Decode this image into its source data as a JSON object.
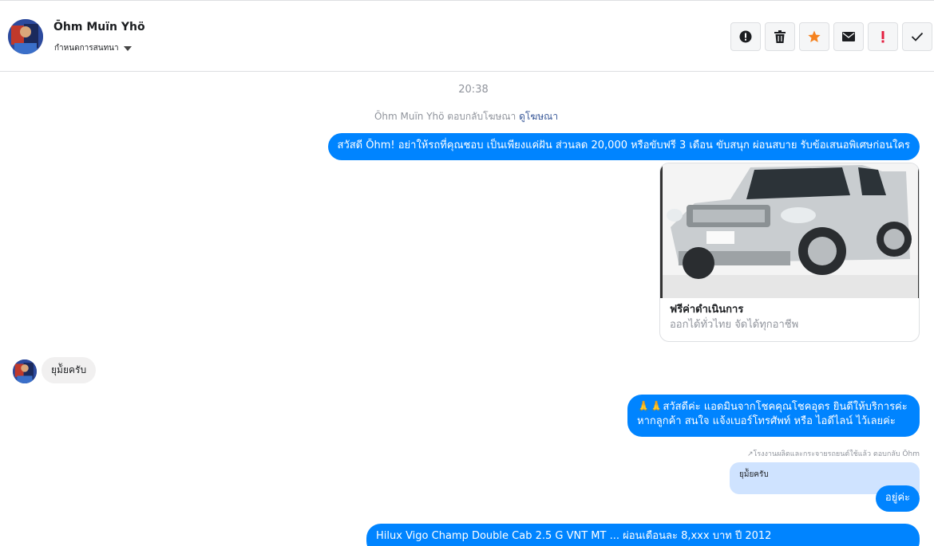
{
  "header": {
    "contact_name": "Ōhm Muïn Yhö",
    "assign_label": "กำหนดการสนทนา"
  },
  "toolbar": {
    "buttons": [
      {
        "name": "spam-button",
        "icon": "alert-circle-icon"
      },
      {
        "name": "delete-button",
        "icon": "trash-icon"
      },
      {
        "name": "star-button",
        "icon": "star-icon",
        "color": "#f5821f"
      },
      {
        "name": "mark-unread-button",
        "icon": "envelope-icon"
      },
      {
        "name": "important-button",
        "icon": "exclamation-icon",
        "color": "#e41e3f"
      },
      {
        "name": "done-button",
        "icon": "check-icon"
      }
    ]
  },
  "conversation": {
    "time": "20:38",
    "reply_note": "Ōhm Muïn Yhö ตอบกลับโฆษณา",
    "reply_link": "ดูโฆษณา",
    "messages": {
      "m1": "สวัสดี Ōhm! อย่าให้รถที่คุณชอบ เป็นเพียงแค่ฝัน ส่วนลด 20,000 หรือขับฟรี 3 เดือน ขับสนุก ผ่อนสบาย รับข้อเสนอพิเศษก่อนใคร",
      "card_title": "ฟรีค่าดำเนินการ",
      "card_subtitle": "ออกได้ทั่วไทย จัดได้ทุกอาชีพ",
      "m2": "ยุม้ัยครับ",
      "m3": "🙏🙏สวัสดีค่ะ แอดมินจากโชคคุณโชคอุดร ยินดีให้บริการค่ะ หากลูกค้า สนใจ แจ้งเบอร์โทรศัพท์ หรือ ไอดีไลน์ ไว้เลยค่ะ",
      "quote_note": "↗โรงงานผลิตและกระจายรถยนต์ใช้แล้ว ตอบกลับ Ōhm",
      "quote_text": "ยุม้ัยครับ",
      "m4": "อยู่ค่ะ",
      "m5": "Hilux Vigo Champ Double Cab 2.5 G VNT MT ... ผ่อนเดือนละ 8,xxx บาท ปี 2012"
    }
  }
}
